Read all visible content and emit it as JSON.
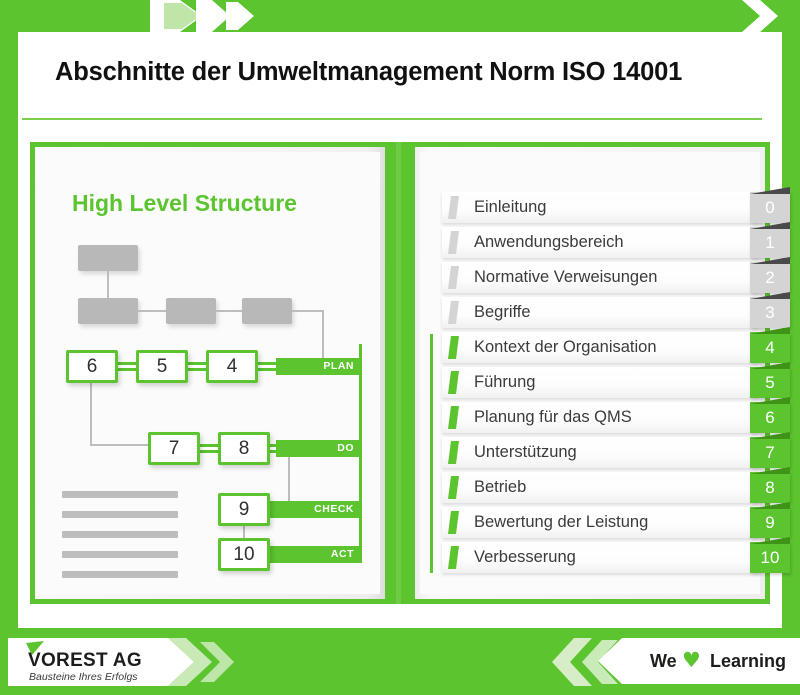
{
  "header": {
    "title": "Abschnitte der Umweltmanagement Norm ISO 14001",
    "accent_color": "#5bc42e",
    "chevron_icon": "chevron-right-icon"
  },
  "left_page": {
    "heading": "High Level Structure",
    "diagram": {
      "type": "flow",
      "numbered_boxes": [
        "6",
        "5",
        "4",
        "7",
        "8",
        "9",
        "10"
      ],
      "cycle_labels": [
        "PLAN",
        "DO",
        "CHECK",
        "ACT"
      ],
      "plan_boxes": [
        "6",
        "5",
        "4"
      ],
      "do_boxes": [
        "7",
        "8"
      ],
      "check_boxes": [
        "9"
      ],
      "act_boxes": [
        "10"
      ],
      "placeholder_box_count": 4,
      "placeholder_line_count": 5
    }
  },
  "right_page": {
    "items": [
      {
        "number": "0",
        "label": "Einleitung",
        "state": "inactive"
      },
      {
        "number": "1",
        "label": "Anwendungsbereich",
        "state": "inactive"
      },
      {
        "number": "2",
        "label": "Normative Verweisungen",
        "state": "inactive"
      },
      {
        "number": "3",
        "label": "Begriffe",
        "state": "inactive"
      },
      {
        "number": "4",
        "label": "Kontext der Organisation",
        "state": "active"
      },
      {
        "number": "5",
        "label": "Führung",
        "state": "active"
      },
      {
        "number": "6",
        "label": "Planung für das QMS",
        "state": "active"
      },
      {
        "number": "7",
        "label": "Unterstützung",
        "state": "active"
      },
      {
        "number": "8",
        "label": "Betrieb",
        "state": "active"
      },
      {
        "number": "9",
        "label": "Bewertung der Leistung",
        "state": "active"
      },
      {
        "number": "10",
        "label": "Verbesserung",
        "state": "active"
      }
    ],
    "active_color": "#5bc42e",
    "inactive_color": "#d4d4d4"
  },
  "footer": {
    "brand_name": "VOREST AG",
    "brand_tagline": "Bausteine Ihres Erfolgs",
    "slogan_prefix": "We",
    "slogan_heart": "♥",
    "slogan_suffix": "Learning",
    "brand_mark_icon": "green-flag-icon",
    "heart_icon": "heart-icon",
    "chevron_left_icon": "chevron-left-icon"
  }
}
